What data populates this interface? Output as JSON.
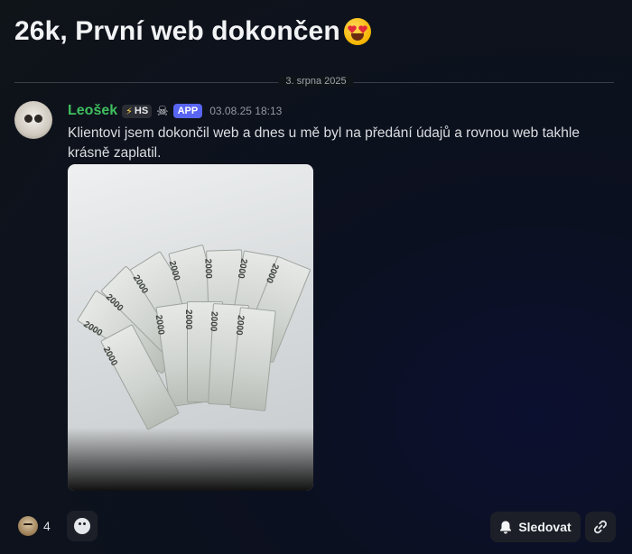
{
  "post": {
    "title": "26k, První web dokončen",
    "title_emoji_icon": "heart-eyes-emoji-icon"
  },
  "divider": {
    "date": "3. srpna 2025"
  },
  "message": {
    "author": "Leošek",
    "badges": {
      "hs_icon": "lightning-icon",
      "hs_label": "HS",
      "skull_icon": "skull-icon",
      "app_label": "APP"
    },
    "timestamp": "03.08.25 18:13",
    "text": "Klientovi jsem dokončil web a dnes u mě byl na předání údajů a rovnou web takhle krásně zaplatil.",
    "attachment": {
      "kind": "photo",
      "subject": "fanned 2000 CZK banknotes on a white table",
      "note_value_text": "2000"
    }
  },
  "footer": {
    "reaction": {
      "icon": "monkey-emoji-icon",
      "count": "4"
    },
    "add_reaction_icon": "add-reaction-smiley-icon",
    "follow_button": {
      "icon": "bell-icon",
      "label": "Sledovat"
    },
    "copy_link_icon": "link-icon"
  },
  "colors": {
    "username": "#3fbf5f",
    "app_badge": "#5865f2",
    "background": "#0f1419",
    "button_bg": "#1c1f27"
  }
}
